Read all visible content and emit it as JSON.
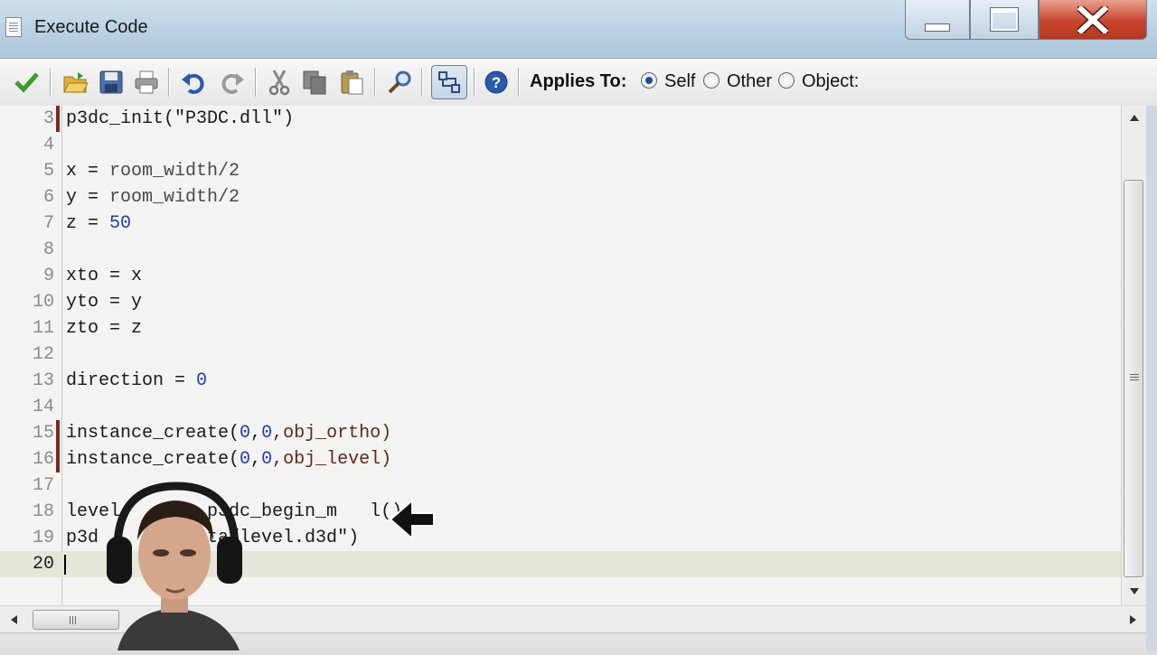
{
  "window": {
    "title": "Execute Code",
    "title_icon": "document-icon",
    "controls": {
      "minimize": "minimize-icon",
      "maximize": "maximize-icon",
      "close": "close-icon"
    }
  },
  "toolbar": {
    "buttons": [
      {
        "name": "ok",
        "icon": "checkmark-icon"
      },
      {
        "name": "open",
        "icon": "open-folder-icon"
      },
      {
        "name": "save",
        "icon": "save-disk-icon"
      },
      {
        "name": "print",
        "icon": "printer-icon"
      },
      {
        "name": "undo",
        "icon": "undo-icon"
      },
      {
        "name": "redo",
        "icon": "redo-icon"
      },
      {
        "name": "cut",
        "icon": "scissors-icon"
      },
      {
        "name": "copy",
        "icon": "copy-icon"
      },
      {
        "name": "paste",
        "icon": "paste-icon"
      },
      {
        "name": "find",
        "icon": "magnifier-icon"
      },
      {
        "name": "code-toggle",
        "icon": "code-view-icon"
      },
      {
        "name": "help",
        "icon": "help-icon"
      }
    ],
    "applies_to_label": "Applies To:",
    "options": [
      {
        "label": "Self",
        "selected": true
      },
      {
        "label": "Other",
        "selected": false
      },
      {
        "label": "Object:",
        "selected": false
      }
    ]
  },
  "editor": {
    "current_line": "20",
    "lines": [
      {
        "n": "3",
        "marked": true,
        "segments": [
          {
            "t": "p3dc_init(",
            "c": "#1a1a1a"
          },
          {
            "t": "\"P3DC.dll\"",
            "c": "#1a1a1a"
          },
          {
            "t": ")",
            "c": "#1a1a1a"
          }
        ]
      },
      {
        "n": "4",
        "marked": false,
        "segments": []
      },
      {
        "n": "5",
        "marked": false,
        "segments": [
          {
            "t": "x = ",
            "c": "#1a1a1a"
          },
          {
            "t": "room_width/2",
            "c": "#4a4a4a"
          }
        ]
      },
      {
        "n": "6",
        "marked": false,
        "segments": [
          {
            "t": "y = ",
            "c": "#1a1a1a"
          },
          {
            "t": "room_width/2",
            "c": "#4a4a4a"
          }
        ]
      },
      {
        "n": "7",
        "marked": false,
        "segments": [
          {
            "t": "z = ",
            "c": "#1a1a1a"
          },
          {
            "t": "50",
            "c": "#1f3fa8"
          }
        ]
      },
      {
        "n": "8",
        "marked": false,
        "segments": []
      },
      {
        "n": "9",
        "marked": false,
        "segments": [
          {
            "t": "xto = x",
            "c": "#1a1a1a"
          }
        ]
      },
      {
        "n": "10",
        "marked": false,
        "segments": [
          {
            "t": "yto = y",
            "c": "#1a1a1a"
          }
        ]
      },
      {
        "n": "11",
        "marked": false,
        "segments": [
          {
            "t": "zto = z",
            "c": "#1a1a1a"
          }
        ]
      },
      {
        "n": "12",
        "marked": false,
        "segments": []
      },
      {
        "n": "13",
        "marked": false,
        "segments": [
          {
            "t": "direction = ",
            "c": "#1a1a1a"
          },
          {
            "t": "0",
            "c": "#1f3fa8"
          }
        ]
      },
      {
        "n": "14",
        "marked": false,
        "segments": []
      },
      {
        "n": "15",
        "marked": true,
        "segments": [
          {
            "t": "instance_create(",
            "c": "#1a1a1a"
          },
          {
            "t": "0",
            "c": "#1f3fa8"
          },
          {
            "t": ",",
            "c": "#1a1a1a"
          },
          {
            "t": "0",
            "c": "#1f3fa8"
          },
          {
            "t": ",obj_ortho)",
            "c": "#5a2a1a"
          }
        ]
      },
      {
        "n": "16",
        "marked": true,
        "segments": [
          {
            "t": "instance_create(",
            "c": "#1a1a1a"
          },
          {
            "t": "0",
            "c": "#1f3fa8"
          },
          {
            "t": ",",
            "c": "#1a1a1a"
          },
          {
            "t": "0",
            "c": "#1f3fa8"
          },
          {
            "t": ",obj_level)",
            "c": "#5a2a1a"
          }
        ]
      },
      {
        "n": "17",
        "marked": false,
        "segments": []
      },
      {
        "n": "18",
        "marked": false,
        "segments": [
          {
            "t": "level",
            "c": "#1a1a1a"
          },
          {
            "t": "      = p3dc_begin_m   l()",
            "c": "#1a1a1a"
          }
        ]
      },
      {
        "n": "19",
        "marked": false,
        "segments": [
          {
            "t": "p3d",
            "c": "#1a1a1a"
          },
          {
            "t": "      ",
            "c": "#1a1a1a"
          },
          {
            "t": "(\"data/level.d3d\")",
            "c": "#1a1a1a"
          }
        ]
      },
      {
        "n": "20",
        "marked": false,
        "segments": []
      }
    ]
  },
  "colors": {
    "accent_check": "#3a9a2a",
    "marker": "#7a2a22",
    "number": "#1f3fa8",
    "close_button": "#c8452d"
  }
}
